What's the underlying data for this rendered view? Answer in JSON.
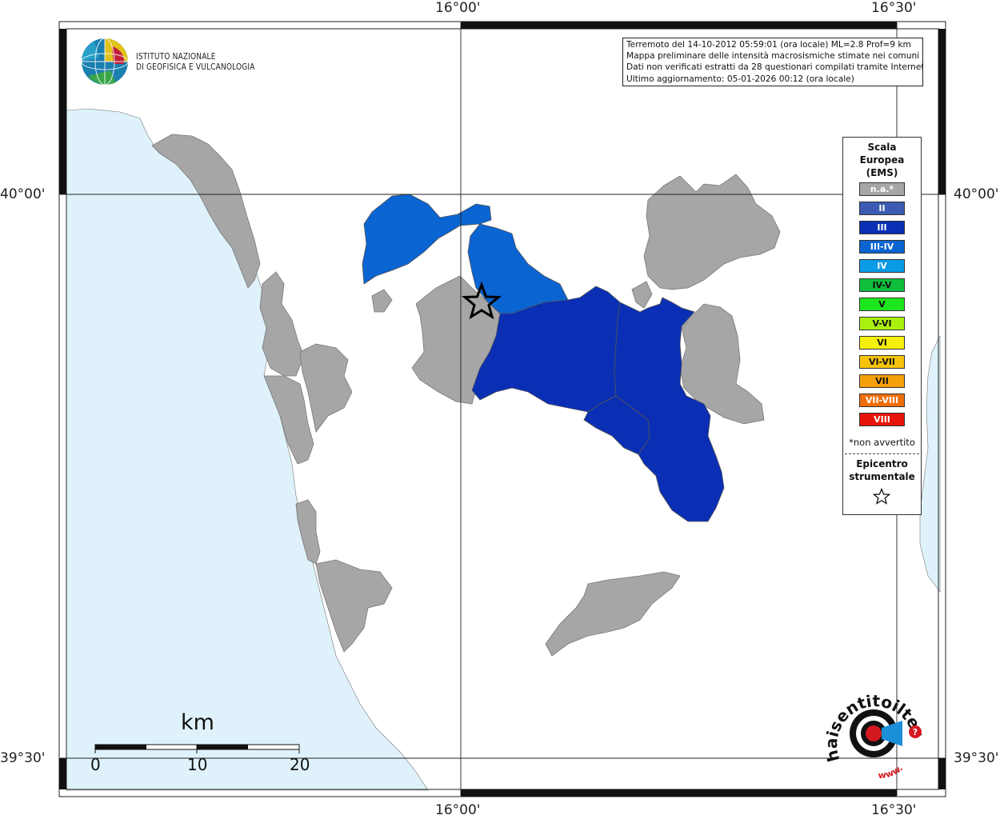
{
  "logo": {
    "line1": "ISTITUTO NAZIONALE",
    "line2": "DI GEOFISICA E VULCANOLOGIA"
  },
  "info": {
    "line1": "Terremoto del 14-10-2012 05:59:01 (ora locale) ML=2.8 Prof=9 km",
    "line2": "Mappa preliminare delle intensità macrosismiche stimate nei comuni",
    "line3": "Dati non verificati estratti da 28 questionari compilati tramite Internet.",
    "line4": "Ultimo aggiornamento: 05-01-2026 00:12 (ora locale)"
  },
  "coords": {
    "top_left": "16°00'",
    "top_right": "16°30'",
    "bottom_left": "16°00'",
    "bottom_right": "16°30'",
    "left_upper": "40°00'",
    "left_lower": "39°30'",
    "right_upper": "40°00'",
    "right_lower": "39°30'"
  },
  "legend": {
    "title_1": "Scala",
    "title_2": "Europea",
    "title_3": "(EMS)",
    "items": [
      {
        "label": "n.a.*",
        "color": "#a6a6a6",
        "text_color": "#ffffff"
      },
      {
        "label": "II",
        "color": "#3c5cb4",
        "text_color": "#ffffff"
      },
      {
        "label": "III",
        "color": "#0a2fb4",
        "text_color": "#ffffff"
      },
      {
        "label": "III-IV",
        "color": "#0a64d2",
        "text_color": "#ffffff"
      },
      {
        "label": "IV",
        "color": "#0a9be6",
        "text_color": "#ffffff"
      },
      {
        "label": "IV-V",
        "color": "#0fbe3c",
        "text_color": "#111111"
      },
      {
        "label": "V",
        "color": "#1ee61e",
        "text_color": "#111111"
      },
      {
        "label": "V-VI",
        "color": "#aaf00f",
        "text_color": "#111111"
      },
      {
        "label": "VI",
        "color": "#f5f00a",
        "text_color": "#111111"
      },
      {
        "label": "VI-VII",
        "color": "#f5c30a",
        "text_color": "#111111"
      },
      {
        "label": "VII",
        "color": "#f5a00a",
        "text_color": "#111111"
      },
      {
        "label": "VII-VIII",
        "color": "#f06e0a",
        "text_color": "#ffffff"
      },
      {
        "label": "VIII",
        "color": "#e6140a",
        "text_color": "#ffffff"
      }
    ],
    "note": "*non avvertito",
    "epicenter_1": "Epicentro",
    "epicenter_2": "strumentale"
  },
  "scale_bar": {
    "unit": "km",
    "ticks": [
      "0",
      "10",
      "20"
    ]
  },
  "colors": {
    "sea": "#dff2fc",
    "land_gray": "#a6a6a6",
    "intensity_III": "#0a2fb4",
    "intensity_III_IV": "#0a64d2"
  },
  "haisentito": {
    "text": "haisentitoilterremoto.it",
    "www": "www."
  }
}
